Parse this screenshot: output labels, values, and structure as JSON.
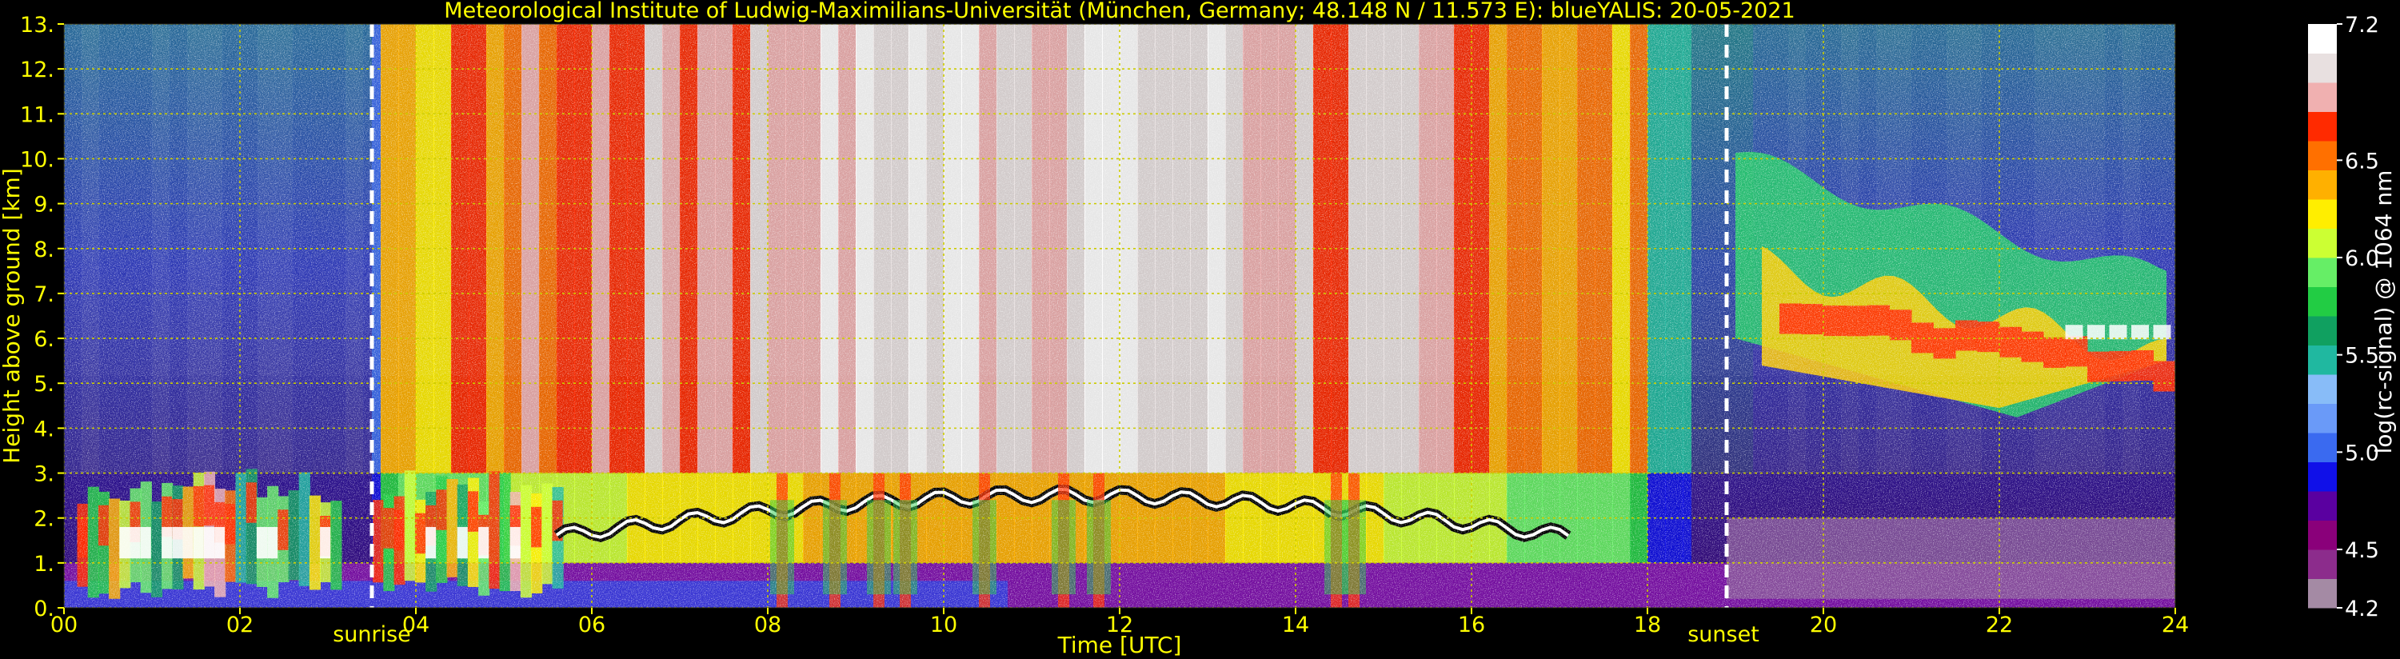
{
  "chart_data": {
    "type": "heatmap",
    "title": "Meteorological Institute of Ludwig-Maximilians-Universität (München, Germany; 48.148 N / 11.573 E):    blueYALIS: 20-05-2021",
    "xlabel": "Time [UTC]",
    "ylabel": "Height above ground [km]",
    "xlim": [
      0,
      24
    ],
    "ylim": [
      0,
      13
    ],
    "x_ticks": [
      "00",
      "02",
      "04",
      "06",
      "08",
      "10",
      "12",
      "14",
      "16",
      "18",
      "20",
      "22",
      "24"
    ],
    "y_ticks": [
      "0.",
      "1.",
      "2.",
      "3.",
      "4.",
      "5.",
      "6.",
      "7.",
      "8.",
      "9.",
      "10.",
      "11.",
      "12.",
      "13."
    ],
    "grid": true,
    "markers": [
      {
        "label": "sunrise",
        "x": 3.5
      },
      {
        "label": "sunset",
        "x": 18.9
      }
    ],
    "colorbar": {
      "label": "log(rc-signal) @ 1064 nm",
      "range": [
        4.2,
        7.2
      ],
      "ticks": [
        "4.2",
        "4.5",
        "5.0",
        "5.5",
        "6.0",
        "6.5",
        "7.2"
      ]
    },
    "features": [
      {
        "name": "boundary layer aerosol",
        "x": [
          0,
          24
        ],
        "y": [
          0,
          1.0
        ]
      },
      {
        "name": "low clouds",
        "x": [
          0.2,
          5.6
        ],
        "y": [
          0.3,
          3.3
        ]
      },
      {
        "name": "cloud tops line",
        "x": [
          5.6,
          17.1
        ],
        "y": [
          1.5,
          2.8
        ]
      },
      {
        "name": "cirrus band",
        "x": [
          19.0,
          24.0
        ],
        "y": [
          4.0,
          10.0
        ]
      }
    ]
  },
  "colors": {
    "text": "#ffff00",
    "grid": "#cccc00",
    "marker": "#ffffff",
    "colormap": [
      "#a48aa4",
      "#8c2c8c",
      "#8a007a",
      "#5a00a0",
      "#1010e8",
      "#3a6af0",
      "#6a9af8",
      "#88bcf8",
      "#20b8a0",
      "#10a060",
      "#22cc44",
      "#66ee66",
      "#ccff33",
      "#ffee00",
      "#ffb000",
      "#ff7000",
      "#ff2a00",
      "#f0b0b0",
      "#e8e0e0",
      "#ffffff"
    ]
  }
}
